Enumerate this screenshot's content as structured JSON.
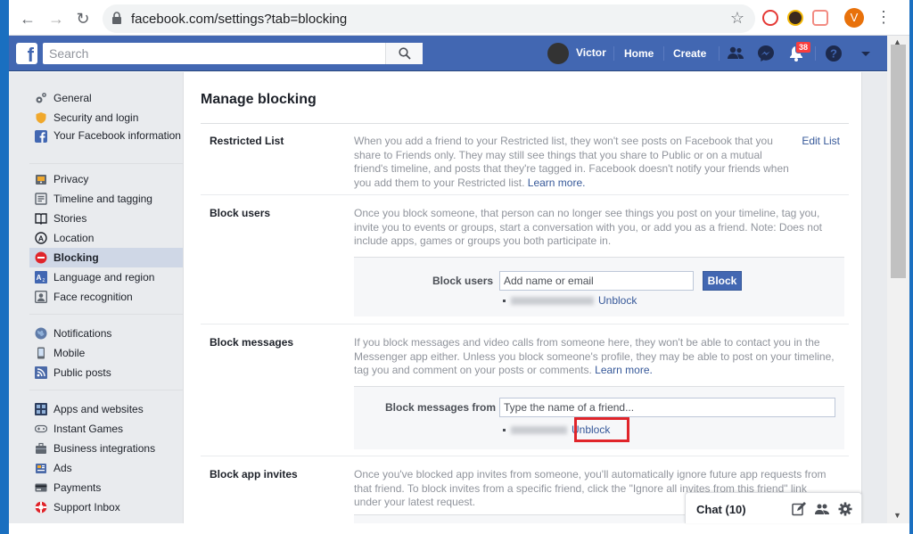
{
  "browser": {
    "url": "facebook.com/settings?tab=blocking",
    "profile_initial": "V"
  },
  "fb": {
    "search_placeholder": "Search",
    "user_name": "Victor",
    "nav_home": "Home",
    "nav_create": "Create",
    "notification_count": "38"
  },
  "sidebar": {
    "groups": [
      [
        {
          "label": "General",
          "icon": "gear-icon"
        },
        {
          "label": "Security and login",
          "icon": "shield-icon"
        },
        {
          "label": "Your Facebook information",
          "icon": "facebook-icon"
        }
      ],
      [
        {
          "label": "Privacy",
          "icon": "lock-icon"
        },
        {
          "label": "Timeline and tagging",
          "icon": "timeline-icon"
        },
        {
          "label": "Stories",
          "icon": "book-icon"
        },
        {
          "label": "Location",
          "icon": "location-icon"
        },
        {
          "label": "Blocking",
          "icon": "block-icon",
          "active": true
        },
        {
          "label": "Language and region",
          "icon": "language-icon"
        },
        {
          "label": "Face recognition",
          "icon": "face-icon"
        }
      ],
      [
        {
          "label": "Notifications",
          "icon": "globe-icon"
        },
        {
          "label": "Mobile",
          "icon": "mobile-icon"
        },
        {
          "label": "Public posts",
          "icon": "rss-icon"
        }
      ],
      [
        {
          "label": "Apps and websites",
          "icon": "apps-icon"
        },
        {
          "label": "Instant Games",
          "icon": "gamepad-icon"
        },
        {
          "label": "Business integrations",
          "icon": "business-icon"
        },
        {
          "label": "Ads",
          "icon": "ads-icon"
        },
        {
          "label": "Payments",
          "icon": "card-icon"
        },
        {
          "label": "Support Inbox",
          "icon": "lifebuoy-icon"
        }
      ]
    ]
  },
  "main": {
    "title": "Manage blocking",
    "restricted": {
      "label": "Restricted List",
      "desc": "When you add a friend to your Restricted list, they won't see posts on Facebook that you share to Friends only. They may still see things that you share to Public or on a mutual friend's timeline, and posts that they're tagged in. Facebook doesn't notify your friends when you add them to your Restricted list.",
      "learn_more": "Learn more.",
      "edit": "Edit List"
    },
    "block_users": {
      "label": "Block users",
      "desc": "Once you block someone, that person can no longer see things you post on your timeline, tag you, invite you to events or groups, start a conversation with you, or add you as a friend. Note: Does not include apps, games or groups you both participate in.",
      "field_label": "Block users",
      "placeholder": "Add name or email",
      "button": "Block",
      "unblock": "Unblock"
    },
    "block_messages": {
      "label": "Block messages",
      "desc": "If you block messages and video calls from someone here, they won't be able to contact you in the Messenger app either. Unless you block someone's profile, they may be able to post on your timeline, tag you and comment on your posts or comments.",
      "learn_more": "Learn more.",
      "field_label": "Block messages from",
      "placeholder": "Type the name of a friend...",
      "unblock": "Unblock"
    },
    "block_app_invites": {
      "label": "Block app invites",
      "desc": "Once you've blocked app invites from someone, you'll automatically ignore future app requests from that friend. To block invites from a specific friend, click the \"Ignore all invites from this friend\" link under your latest request."
    }
  },
  "chat": {
    "title": "Chat (10)"
  },
  "colors": {
    "fb_blue": "#4267b2",
    "link": "#365899",
    "highlight_red": "#e0242a"
  }
}
